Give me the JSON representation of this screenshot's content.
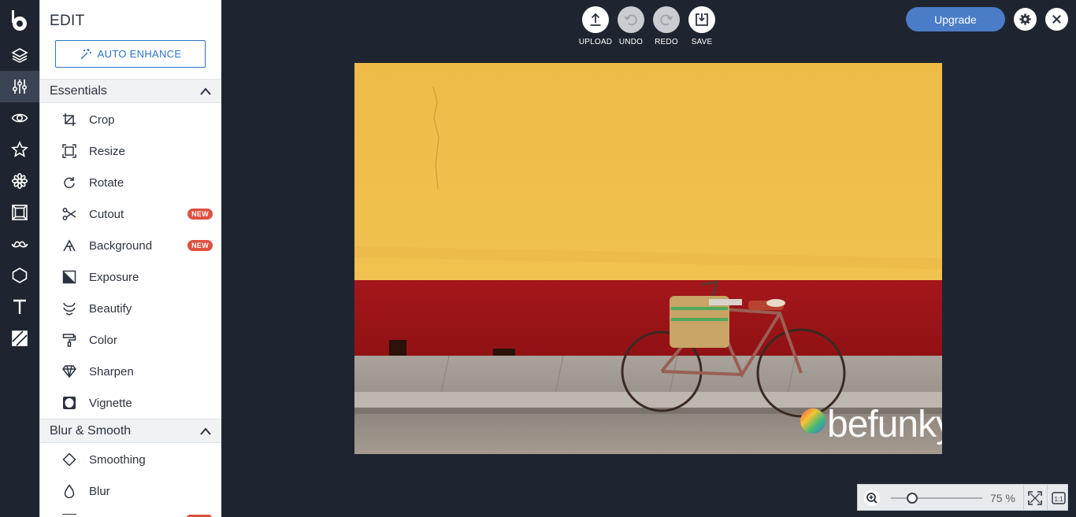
{
  "app": {
    "logo": "befunky-b-logo"
  },
  "rail": {
    "items": [
      {
        "name": "layers",
        "icon": "layers-icon"
      },
      {
        "name": "edit",
        "icon": "sliders-icon",
        "active": true
      },
      {
        "name": "effects",
        "icon": "eye-icon"
      },
      {
        "name": "artsy",
        "icon": "star-icon"
      },
      {
        "name": "touch-up",
        "icon": "flower-icon"
      },
      {
        "name": "frames",
        "icon": "frame-icon"
      },
      {
        "name": "graphics",
        "icon": "mustache-icon"
      },
      {
        "name": "overlays",
        "icon": "shape-icon"
      },
      {
        "name": "text",
        "icon": "text-icon"
      },
      {
        "name": "textures",
        "icon": "texture-icon"
      }
    ]
  },
  "panel": {
    "title": "EDIT",
    "auto_enhance": "AUTO ENHANCE",
    "sections": [
      {
        "title": "Essentials",
        "tools": [
          {
            "label": "Crop",
            "icon": "crop-icon"
          },
          {
            "label": "Resize",
            "icon": "resize-icon"
          },
          {
            "label": "Rotate",
            "icon": "rotate-icon"
          },
          {
            "label": "Cutout",
            "icon": "scissors-icon",
            "badge": "NEW"
          },
          {
            "label": "Background",
            "icon": "background-remover-icon",
            "badge": "NEW"
          },
          {
            "label": "Exposure",
            "icon": "exposure-icon"
          },
          {
            "label": "Beautify",
            "icon": "beautify-icon"
          },
          {
            "label": "Color",
            "icon": "paint-roller-icon"
          },
          {
            "label": "Sharpen",
            "icon": "diamond-icon"
          },
          {
            "label": "Vignette",
            "icon": "vignette-icon"
          }
        ]
      },
      {
        "title": "Blur & Smooth",
        "tools": [
          {
            "label": "Smoothing",
            "icon": "smoothing-icon"
          },
          {
            "label": "Blur",
            "icon": "drop-icon"
          }
        ]
      }
    ]
  },
  "toolbar": {
    "upload": "UPLOAD",
    "undo": "UNDO",
    "redo": "REDO",
    "save": "SAVE"
  },
  "header": {
    "upgrade": "Upgrade"
  },
  "canvas": {
    "watermark": "befunky"
  },
  "zoom": {
    "value": "75 %",
    "level": 0.23
  },
  "colors": {
    "background": "#1f2530",
    "accent": "#4a7cc7",
    "badge": "#e0503f",
    "wall_yellow": "#efbd4b",
    "wall_red": "#9d1316"
  }
}
